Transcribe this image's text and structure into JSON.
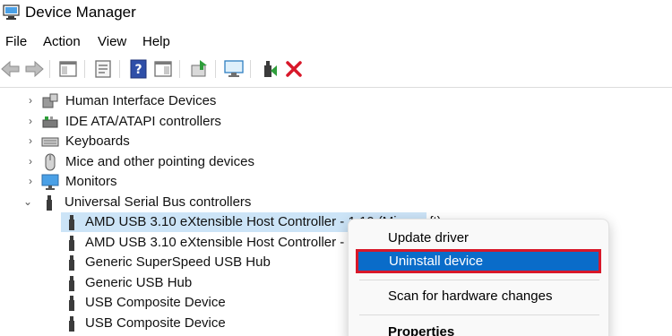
{
  "window": {
    "title": "Device Manager"
  },
  "menu": [
    "File",
    "Action",
    "View",
    "Help"
  ],
  "toolbar": {
    "icons": [
      "back-arrow-icon",
      "forward-arrow-icon",
      "show-hide-console-tree-icon",
      "properties-icon",
      "help-icon",
      "action-pane-icon",
      "update-driver-icon",
      "scan-hardware-icon",
      "enable-device-icon",
      "uninstall-x-icon"
    ]
  },
  "tree": {
    "categories": [
      {
        "label": "Human Interface Devices",
        "expanded": false
      },
      {
        "label": "IDE ATA/ATAPI controllers",
        "expanded": false
      },
      {
        "label": "Keyboards",
        "expanded": false
      },
      {
        "label": "Mice and other pointing devices",
        "expanded": false
      },
      {
        "label": "Monitors",
        "expanded": false
      },
      {
        "label": "Universal Serial Bus controllers",
        "expanded": true
      }
    ],
    "usb_children": [
      {
        "label": "AMD USB 3.10 eXtensible Host Controller - 1.10 (Microsoft)",
        "selected": true
      },
      {
        "label": "AMD USB 3.10 eXtensible Host Controller - 1.1",
        "selected": false
      },
      {
        "label": "Generic SuperSpeed USB Hub",
        "selected": false
      },
      {
        "label": "Generic USB Hub",
        "selected": false
      },
      {
        "label": "USB Composite Device",
        "selected": false
      },
      {
        "label": "USB Composite Device",
        "selected": false
      }
    ]
  },
  "context_menu": {
    "update_driver": "Update driver",
    "uninstall_device": "Uninstall device",
    "scan_hardware": "Scan for hardware changes",
    "properties": "Properties"
  },
  "colors": {
    "selection": "#cce4f7",
    "highlight": "#0a6cc9",
    "highlight_border": "#d8182a",
    "uninstall_red": "#d8182a"
  }
}
